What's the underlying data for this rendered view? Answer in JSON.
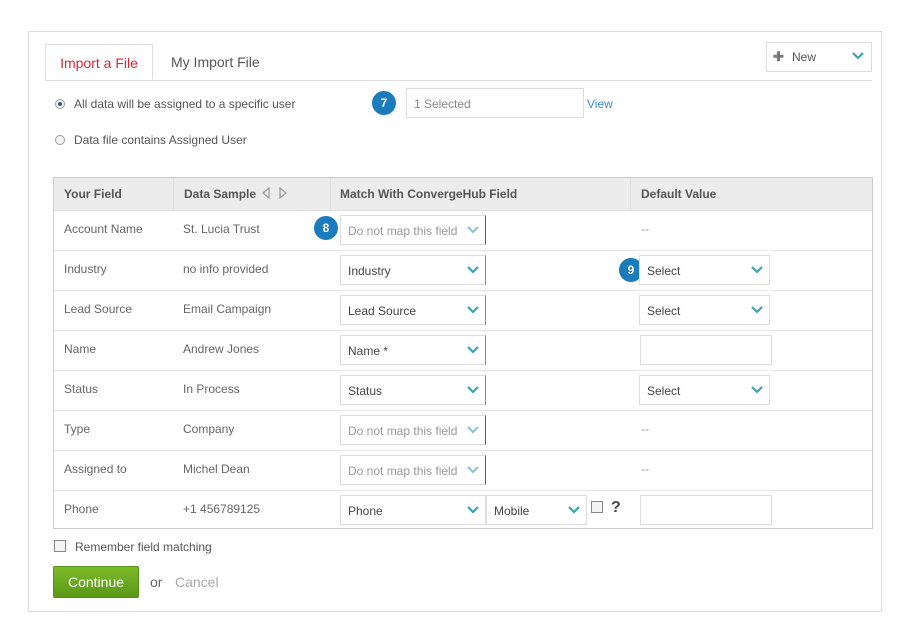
{
  "tabs": [
    {
      "label": "Import a File",
      "active": true
    },
    {
      "label": "My Import File",
      "active": false
    }
  ],
  "new_button": {
    "label": "New",
    "icon": "plus-icon"
  },
  "assign": {
    "option1_label": "All data will be assigned to a specific user",
    "option2_label": "Data file contains Assigned User",
    "selected_option": 1,
    "step_badge": "7",
    "selected_text": "1 Selected",
    "view_link": "View"
  },
  "table": {
    "headers": {
      "your_field": "Your Field",
      "data_sample": "Data Sample",
      "match_field": "Match With ConvergeHub Field",
      "default_value": "Default Value"
    },
    "badges": {
      "match": "8",
      "default": "9"
    },
    "rows": [
      {
        "field": "Account Name",
        "sample": "St. Lucia Trust",
        "match": "Do not map this field",
        "default": "--"
      },
      {
        "field": "Industry",
        "sample": "no info provided",
        "match": "Industry",
        "default": "Select"
      },
      {
        "field": "Lead Source",
        "sample": "Email Campaign",
        "match": "Lead Source",
        "default": "Select"
      },
      {
        "field": "Name",
        "sample": "Andrew Jones",
        "match": "Name *",
        "default": ""
      },
      {
        "field": "Status",
        "sample": "In Process",
        "match": "Status",
        "default": "Select"
      },
      {
        "field": "Type",
        "sample": "Company",
        "match": "Do not map this field",
        "default": "--"
      },
      {
        "field": "Assigned to",
        "sample": "Michel Dean",
        "match": "Do not map this field",
        "default": "--"
      },
      {
        "field": "Phone",
        "sample": "+1 456789125",
        "match": "Phone",
        "phone_type": "Mobile",
        "help": "?",
        "default": ""
      }
    ]
  },
  "remember_label": "Remember field matching",
  "continue_label": "Continue",
  "or_label": "or",
  "cancel_label": "Cancel",
  "colors": {
    "accent_red": "#d12a37",
    "link_blue": "#3a8fc7",
    "badge_blue": "#1a7bbd",
    "continue_green": "#6aab22",
    "chevron_teal": "#3aa3ad"
  }
}
